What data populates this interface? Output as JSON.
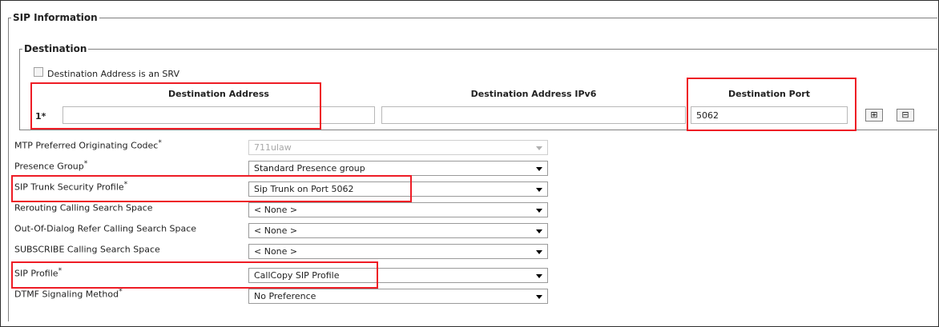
{
  "sip_information": {
    "title": "SIP Information",
    "destination": {
      "title": "Destination",
      "srv_checkbox_label": "Destination Address is an SRV",
      "srv_checked": false,
      "headers": {
        "address": "Destination Address",
        "address_ipv6": "Destination Address IPv6",
        "port": "Destination Port"
      },
      "row": {
        "index_label": "1*",
        "address_value": "",
        "address_ipv6_value": "",
        "port_value": "5062"
      },
      "add_button": "⊞",
      "remove_button": "⊟"
    },
    "fields": [
      {
        "label": "MTP Preferred Originating Codec",
        "required": "*",
        "value": "711ulaw",
        "disabled": true
      },
      {
        "label": "Presence Group",
        "required": "*",
        "value": "Standard Presence group"
      },
      {
        "label": "SIP Trunk Security Profile",
        "required": "*",
        "value": "Sip Trunk on Port 5062"
      },
      {
        "label": "Rerouting Calling Search Space",
        "required": "",
        "value": "< None >"
      },
      {
        "label": "Out-Of-Dialog Refer Calling Search Space",
        "required": "",
        "value": "< None >"
      },
      {
        "label": "SUBSCRIBE Calling Search Space",
        "required": "",
        "value": "< None >"
      },
      {
        "label": "SIP Profile",
        "required": "*",
        "value": "CallCopy SIP Profile"
      },
      {
        "label": "DTMF Signaling Method",
        "required": "*",
        "value": "No Preference"
      }
    ]
  },
  "colors": {
    "highlight": "#ee1c25"
  }
}
